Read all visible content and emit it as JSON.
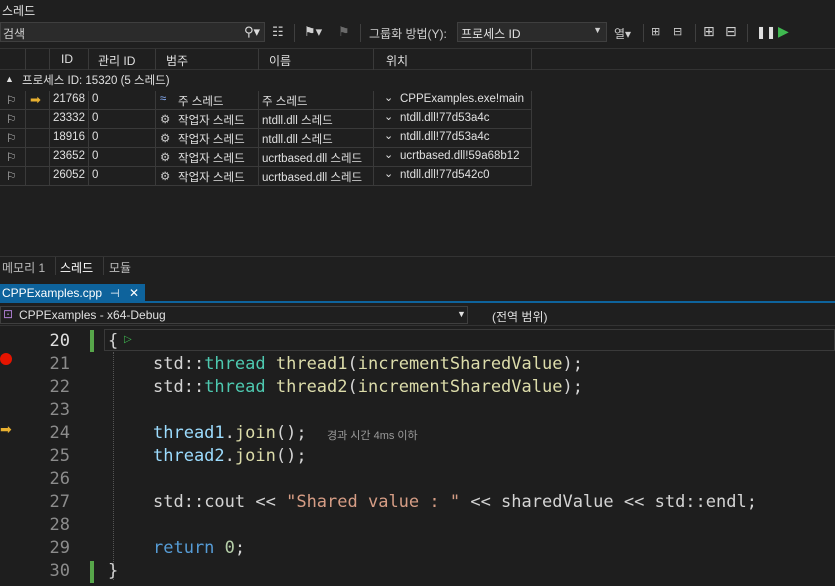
{
  "threads_window": {
    "title": "스레드",
    "search_placeholder": "검색",
    "group_by_label": "그룹화 방법(Y):",
    "group_by_value": "프로세스 ID",
    "columns_label": "열",
    "columns": [
      "ID",
      "관리 ID",
      "범주",
      "이름",
      "위치"
    ],
    "group_header": "프로세스 ID: 15320  (5 스레드)",
    "rows": [
      {
        "id": "21768",
        "managed_id": "0",
        "category": "주 스레드",
        "name": "주 스레드",
        "location": "CPPExamples.exe!main",
        "current": true
      },
      {
        "id": "23332",
        "managed_id": "0",
        "category": "작업자 스레드",
        "name": "ntdll.dll 스레드",
        "location": "ntdll.dll!77d53a4c",
        "current": false
      },
      {
        "id": "18916",
        "managed_id": "0",
        "category": "작업자 스레드",
        "name": "ntdll.dll 스레드",
        "location": "ntdll.dll!77d53a4c",
        "current": false
      },
      {
        "id": "23652",
        "managed_id": "0",
        "category": "작업자 스레드",
        "name": "ucrtbased.dll 스레드",
        "location": "ucrtbased.dll!59a68b12",
        "current": false
      },
      {
        "id": "26052",
        "managed_id": "0",
        "category": "작업자 스레드",
        "name": "ucrtbased.dll 스레드",
        "location": "ntdll.dll!77d542c0",
        "current": false
      }
    ]
  },
  "bottom_tabs": [
    "메모리 1",
    "스레드",
    "모듈"
  ],
  "active_bottom_tab": "스레드",
  "editor": {
    "file_tab": "CPPExamples.cpp",
    "project_combo": "CPPExamples - x64-Debug",
    "scope_combo": "(전역 범위)",
    "elapsed_hint": "경과 시간 4ms 이하",
    "line_numbers": [
      "20",
      "21",
      "22",
      "23",
      "24",
      "25",
      "26",
      "27",
      "28",
      "29",
      "30"
    ],
    "lines": {
      "l20": "{",
      "l21_a": "std::",
      "l21_b": "thread",
      "l21_c": " ",
      "l21_d": "thread1",
      "l21_e": "(",
      "l21_f": "incrementSharedValue",
      "l21_g": ");",
      "l22_a": "std::",
      "l22_b": "thread",
      "l22_c": " ",
      "l22_d": "thread2",
      "l22_e": "(",
      "l22_f": "incrementSharedValue",
      "l22_g": ");",
      "l24_a": "thread1",
      "l24_b": ".",
      "l24_c": "join",
      "l24_d": "();",
      "l25_a": "thread2",
      "l25_b": ".",
      "l25_c": "join",
      "l25_d": "();",
      "l27_a": "std::",
      "l27_b": "cout",
      "l27_c": " << ",
      "l27_d": "\"Shared value : \"",
      "l27_e": " << ",
      "l27_f": "sharedValue",
      "l27_g": " << ",
      "l27_h": "std::",
      "l27_i": "endl",
      "l27_j": ";",
      "l29_a": "return",
      "l29_b": " ",
      "l29_c": "0",
      "l29_d": ";",
      "l30": "}"
    }
  },
  "colors": {
    "accent": "#0e639c",
    "breakpoint": "#e51400",
    "current_arrow": "#e8b030",
    "change_bar": "#57a64a"
  }
}
